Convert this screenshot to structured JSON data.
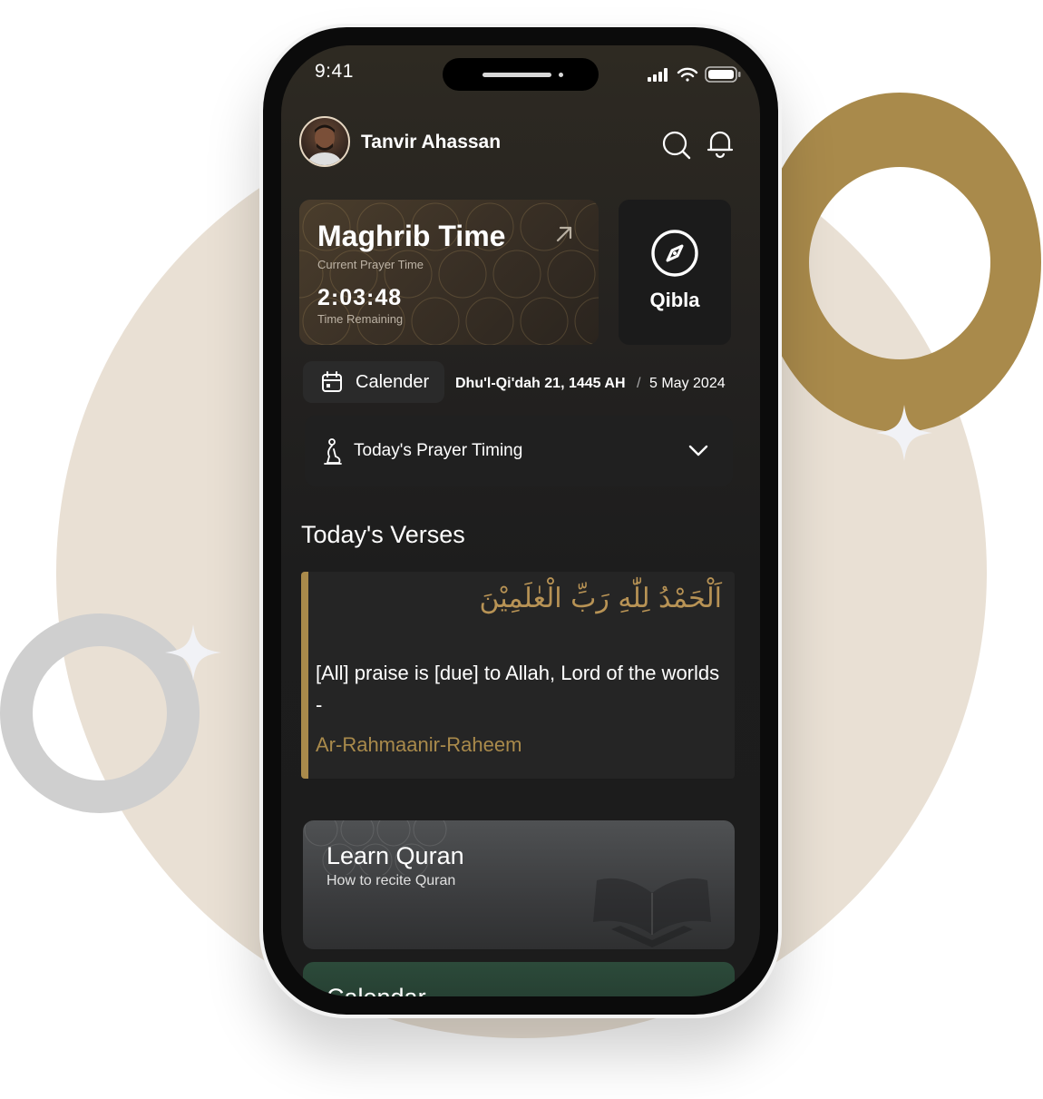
{
  "status_bar": {
    "time": "9:41"
  },
  "header": {
    "user_name": "Tanvir Ahassan"
  },
  "prayer_card": {
    "title": "Maghrib Time",
    "subtitle": "Current Prayer Time",
    "countdown": "2:03:48",
    "countdown_label": "Time Remaining"
  },
  "qibla": {
    "label": "Qibla"
  },
  "calendar_row": {
    "button_label": "Calender",
    "hijri_date": "Dhu'l-Qi'dah 21, 1445 AH",
    "separator": "/",
    "gregorian_date": "5 May 2024"
  },
  "prayer_timing": {
    "label": "Today's Prayer Timing"
  },
  "verses": {
    "heading": "Today's Verses",
    "arabic": "اَلْحَمْدُ لِلّٰهِ رَبِّ الْعٰلَمِيْنَ",
    "translation": "[All] praise is [due] to Allah, Lord of the worlds -",
    "transliteration": "Ar-Rahmaanir-Raheem"
  },
  "learn_quran": {
    "title": "Learn Quran",
    "subtitle": "How to recite Quran"
  },
  "calendar_card": {
    "title": "Calendar"
  },
  "colors": {
    "accent_gold": "#a98a4b",
    "background": "#1c1c1c",
    "bg_circle": "#e9e0d4"
  },
  "icons": [
    "search-icon",
    "bell-icon",
    "arrow-up-right-icon",
    "compass-icon",
    "calendar-icon",
    "prayer-icon",
    "chevron-down-icon",
    "book-icon"
  ]
}
